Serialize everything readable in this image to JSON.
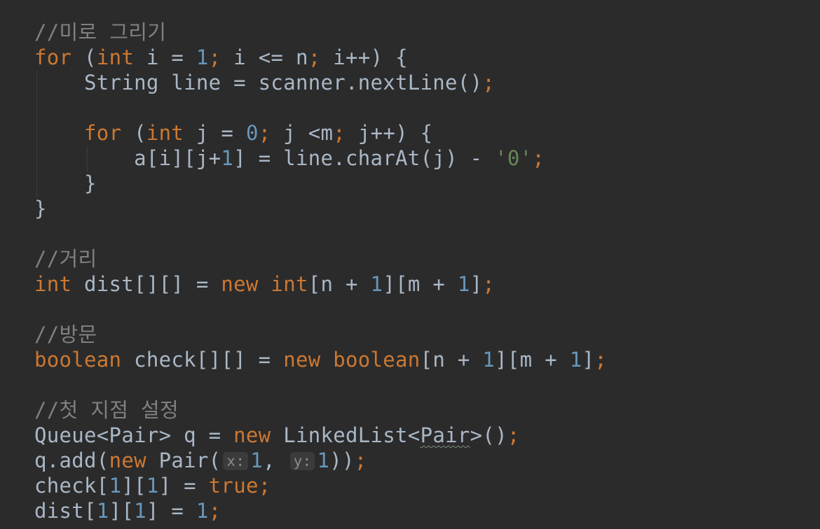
{
  "editor": {
    "lines": [
      {
        "tokens": [
          {
            "t": "comment",
            "v": "//미로 그리기"
          }
        ]
      },
      {
        "tokens": [
          {
            "t": "keyword",
            "v": "for"
          },
          {
            "t": "plain",
            "v": " ("
          },
          {
            "t": "keyword",
            "v": "int"
          },
          {
            "t": "plain",
            "v": " i = "
          },
          {
            "t": "number",
            "v": "1"
          },
          {
            "t": "keyword",
            "v": ";"
          },
          {
            "t": "plain",
            "v": " i <= n"
          },
          {
            "t": "keyword",
            "v": ";"
          },
          {
            "t": "plain",
            "v": " i++) {"
          }
        ]
      },
      {
        "tokens": [
          {
            "t": "plain",
            "v": "    String line = scanner.nextLine()"
          },
          {
            "t": "keyword",
            "v": ";"
          }
        ]
      },
      {
        "tokens": []
      },
      {
        "tokens": [
          {
            "t": "plain",
            "v": "    "
          },
          {
            "t": "keyword",
            "v": "for"
          },
          {
            "t": "plain",
            "v": " ("
          },
          {
            "t": "keyword",
            "v": "int"
          },
          {
            "t": "plain",
            "v": " j = "
          },
          {
            "t": "number",
            "v": "0"
          },
          {
            "t": "keyword",
            "v": ";"
          },
          {
            "t": "plain",
            "v": " j <m"
          },
          {
            "t": "keyword",
            "v": ";"
          },
          {
            "t": "plain",
            "v": " j++) {"
          }
        ]
      },
      {
        "tokens": [
          {
            "t": "plain",
            "v": "        a[i][j+"
          },
          {
            "t": "number",
            "v": "1"
          },
          {
            "t": "plain",
            "v": "] = line.charAt(j) - "
          },
          {
            "t": "string",
            "v": "'0'"
          },
          {
            "t": "keyword",
            "v": ";"
          }
        ]
      },
      {
        "tokens": [
          {
            "t": "plain",
            "v": "    }"
          }
        ]
      },
      {
        "tokens": [
          {
            "t": "plain",
            "v": "}"
          }
        ]
      },
      {
        "tokens": []
      },
      {
        "tokens": [
          {
            "t": "comment",
            "v": "//거리"
          }
        ]
      },
      {
        "tokens": [
          {
            "t": "keyword",
            "v": "int"
          },
          {
            "t": "plain",
            "v": " dist[][] = "
          },
          {
            "t": "keyword",
            "v": "new"
          },
          {
            "t": "plain",
            "v": " "
          },
          {
            "t": "keyword",
            "v": "int"
          },
          {
            "t": "plain",
            "v": "[n + "
          },
          {
            "t": "number",
            "v": "1"
          },
          {
            "t": "plain",
            "v": "][m + "
          },
          {
            "t": "number",
            "v": "1"
          },
          {
            "t": "plain",
            "v": "]"
          },
          {
            "t": "keyword",
            "v": ";"
          }
        ]
      },
      {
        "tokens": []
      },
      {
        "tokens": [
          {
            "t": "comment",
            "v": "//방문"
          }
        ]
      },
      {
        "tokens": [
          {
            "t": "keyword",
            "v": "boolean"
          },
          {
            "t": "plain",
            "v": " check[][] = "
          },
          {
            "t": "keyword",
            "v": "new"
          },
          {
            "t": "plain",
            "v": " "
          },
          {
            "t": "keyword",
            "v": "boolean"
          },
          {
            "t": "plain",
            "v": "[n + "
          },
          {
            "t": "number",
            "v": "1"
          },
          {
            "t": "plain",
            "v": "][m + "
          },
          {
            "t": "number",
            "v": "1"
          },
          {
            "t": "plain",
            "v": "]"
          },
          {
            "t": "keyword",
            "v": ";"
          }
        ]
      },
      {
        "tokens": []
      },
      {
        "tokens": [
          {
            "t": "comment",
            "v": "//첫 지점 설정"
          }
        ]
      },
      {
        "tokens": [
          {
            "t": "plain",
            "v": "Queue<Pair> q = "
          },
          {
            "t": "keyword",
            "v": "new"
          },
          {
            "t": "plain",
            "v": " LinkedList<"
          },
          {
            "t": "warn",
            "v": "Pair"
          },
          {
            "t": "plain",
            "v": ">()"
          },
          {
            "t": "keyword",
            "v": ";"
          }
        ]
      },
      {
        "tokens": [
          {
            "t": "plain",
            "v": "q.add("
          },
          {
            "t": "keyword",
            "v": "new"
          },
          {
            "t": "plain",
            "v": " Pair("
          },
          {
            "t": "hint",
            "v": "x:"
          },
          {
            "t": "number",
            "v": "1"
          },
          {
            "t": "plain",
            "v": ", "
          },
          {
            "t": "hint",
            "v": "y:"
          },
          {
            "t": "number",
            "v": "1"
          },
          {
            "t": "plain",
            "v": "))"
          },
          {
            "t": "keyword",
            "v": ";"
          }
        ]
      },
      {
        "tokens": [
          {
            "t": "plain",
            "v": "check["
          },
          {
            "t": "number",
            "v": "1"
          },
          {
            "t": "plain",
            "v": "]["
          },
          {
            "t": "number",
            "v": "1"
          },
          {
            "t": "plain",
            "v": "] = "
          },
          {
            "t": "keyword",
            "v": "true"
          },
          {
            "t": "keyword",
            "v": ";"
          }
        ]
      },
      {
        "tokens": [
          {
            "t": "plain",
            "v": "dist["
          },
          {
            "t": "number",
            "v": "1"
          },
          {
            "t": "plain",
            "v": "]["
          },
          {
            "t": "number",
            "v": "1"
          },
          {
            "t": "plain",
            "v": "] = "
          },
          {
            "t": "number",
            "v": "1"
          },
          {
            "t": "keyword",
            "v": ";"
          }
        ]
      }
    ]
  },
  "colors": {
    "background": "#2b2b2b",
    "plain": "#a9b7c6",
    "keyword": "#cc7832",
    "number": "#6897bb",
    "string": "#6a8759",
    "comment": "#808080",
    "hint_background": "#3b3b3b",
    "hint_text": "#8a8a8a"
  }
}
